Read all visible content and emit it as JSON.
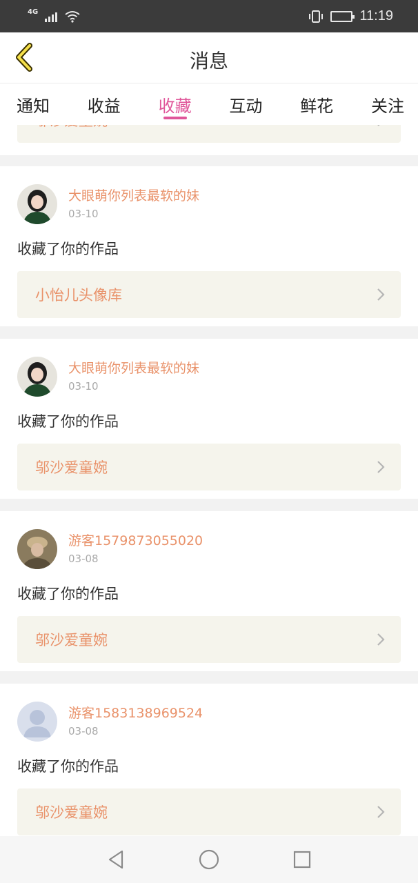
{
  "status_bar": {
    "network": "4G",
    "time": "11:19"
  },
  "header": {
    "title": "消息",
    "back_icon": "chevron-left-icon",
    "accent_color": "#e0569a"
  },
  "tabs": [
    {
      "label": "通知",
      "active": false
    },
    {
      "label": "收益",
      "active": false
    },
    {
      "label": "收藏",
      "active": true
    },
    {
      "label": "互动",
      "active": false
    },
    {
      "label": "鲜花",
      "active": false
    },
    {
      "label": "关注",
      "active": false
    }
  ],
  "partial_card": {
    "work_title": "邬沙爱童婉"
  },
  "cards": [
    {
      "user_name": "大眼萌你列表最软的妹",
      "date": "03-10",
      "action": "收藏了你的作品",
      "work_title": "小怡儿头像库",
      "avatar": "girl-photo-avatar"
    },
    {
      "user_name": "大眼萌你列表最软的妹",
      "date": "03-10",
      "action": "收藏了你的作品",
      "work_title": "邬沙爱童婉",
      "avatar": "girl-photo-avatar"
    },
    {
      "user_name": "游客1579873055020",
      "date": "03-08",
      "action": "收藏了你的作品",
      "work_title": "邬沙爱童婉",
      "avatar": "cap-photo-avatar"
    },
    {
      "user_name": "游客1583138969524",
      "date": "03-08",
      "action": "收藏了你的作品",
      "work_title": "邬沙爱童婉",
      "avatar": "default-user-avatar"
    }
  ],
  "colors": {
    "name_text": "#e9926a",
    "link_bg": "#f5f4ec",
    "page_bg": "#f2f2f2"
  },
  "nav": {
    "back": "back-triangle-icon",
    "home": "home-circle-icon",
    "recents": "recents-square-icon"
  }
}
